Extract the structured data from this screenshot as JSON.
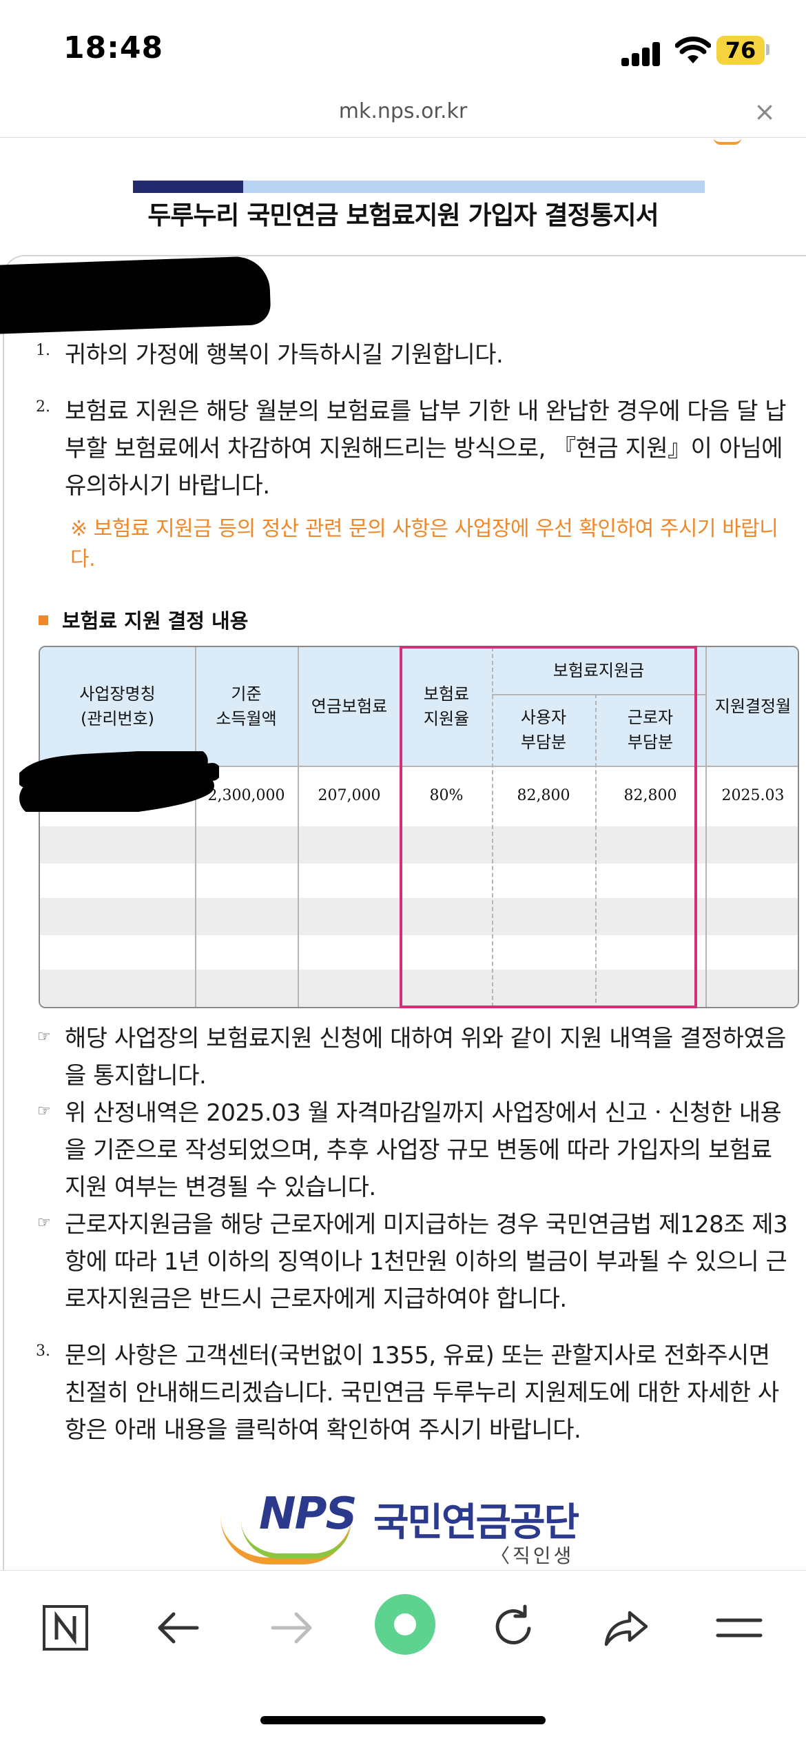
{
  "status_bar": {
    "time": "18:48",
    "battery": "76"
  },
  "url_bar": {
    "domain": "mk.nps.or.kr",
    "close_glyph": "×"
  },
  "document": {
    "title": "두루누리 국민연금 보험료지원 가입자 결정통지서",
    "paragraphs": [
      {
        "num": "1.",
        "text": "귀하의 가정에 행복이 가득하시길 기원합니다."
      },
      {
        "num": "2.",
        "text": "보험료 지원은 해당 월분의 보험료를 납부 기한 내 완납한 경우에 다음 달 납부할 보험료에서 차감하여 지원해드리는 방식으로, 『현금 지원』이 아님에 유의하시기 바랍니다."
      }
    ],
    "notice": "※ 보험료 지원금 등의 정산 관련 문의 사항은 사업장에 우선 확인하여 주시기 바랍니다.",
    "section_title": "보험료 지원 결정 내용",
    "table": {
      "headers": {
        "company": "사업장명칭\n(관리번호)",
        "base_income": "기준\n소득월액",
        "annual_premium": "연금보험료",
        "support_rate": "보험료\n지원율",
        "support_group": "보험료지원금",
        "employer_share": "사용자\n부담분",
        "worker_share": "근로자\n부담분",
        "decision_month": "지원결정월"
      },
      "row": {
        "company": "",
        "base_income": "2,300,000",
        "annual_premium": "207,000",
        "support_rate": "80%",
        "employer_share": "82,800",
        "worker_share": "82,800",
        "decision_month": "2025.03"
      }
    },
    "bullets": [
      "해당 사업장의 보험료지원 신청에 대하여 위와 같이 지원 내역을 결정하였음을 통지합니다.",
      "위 산정내역은 2025.03 월 자격마감일까지 사업장에서 신고ㆍ신청한 내용을 기준으로 작성되었으며, 추후 사업장 규모 변동에 따라 가입자의 보험료 지원 여부는 변경될 수 있습니다.",
      "근로자지원금을 해당 근로자에게 미지급하는 경우 국민연금법 제128조 제3항에 따라 1년 이하의 징역이나 1천만원 이하의 벌금이 부과될 수 있으니 근로자지원금은 반드시 근로자에게 지급하여야 합니다."
    ],
    "bullet_glyph": "☞",
    "paragraph3": {
      "num": "3.",
      "text": "문의 사항은 고객센터(국번없이 1355, 유료) 또는 관할지사로 전화주시면 친절히 안내해드리겠습니다. 국민연금 두루누리 지원제도에 대한 자세한 사항은 아래 내용을 클릭하여 확인하여 주시기 바랍니다."
    },
    "logo": {
      "nps": "NPS",
      "name": "국민연금공단",
      "sub": "〈직인생략〉"
    }
  },
  "toolbar": {
    "icons": [
      "naver-n-icon",
      "back-arrow-icon",
      "forward-arrow-icon",
      "green-dot-icon",
      "reload-icon",
      "share-icon",
      "menu-icon"
    ]
  },
  "colors": {
    "highlight": "#d4307a",
    "accent_orange": "#f0882a",
    "header_fill": "#dcebf8",
    "brand_navy": "#232a6e",
    "brand_green": "#5ed38f"
  }
}
